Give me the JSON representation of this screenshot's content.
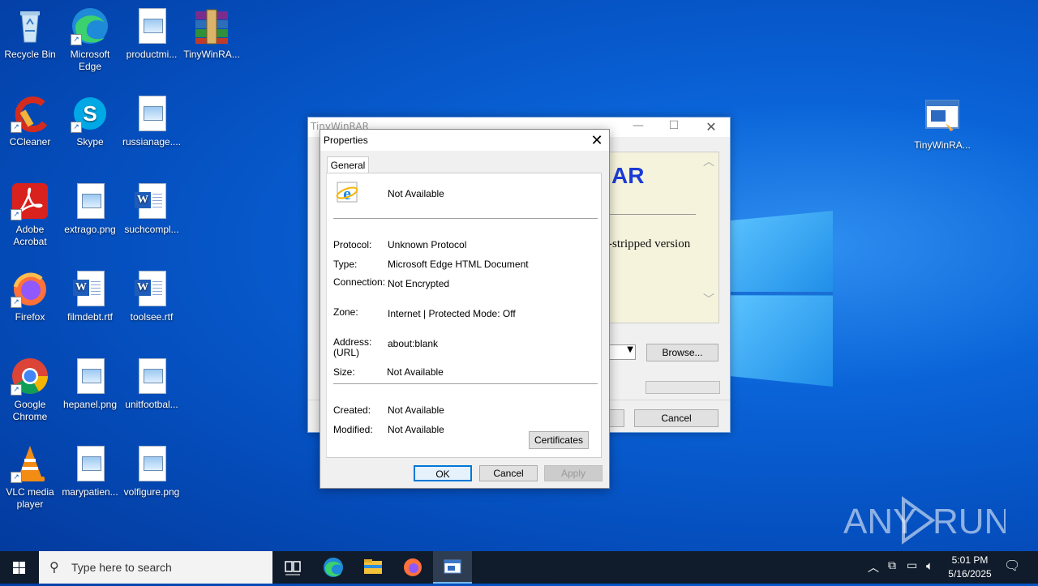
{
  "desktop_icons": [
    {
      "name": "recycle-bin",
      "label": "Recycle Bin"
    },
    {
      "name": "microsoft-edge",
      "label": "Microsoft Edge"
    },
    {
      "name": "productmi",
      "label": "productmi..."
    },
    {
      "name": "tinywinrar-archive",
      "label": "TinyWinRA..."
    },
    {
      "name": "ccleaner",
      "label": "CCleaner"
    },
    {
      "name": "skype",
      "label": "Skype"
    },
    {
      "name": "russianage",
      "label": "russianage...."
    },
    {
      "name": "adobe-acrobat",
      "label": "Adobe Acrobat"
    },
    {
      "name": "extrago",
      "label": "extrago.png"
    },
    {
      "name": "suchcompl",
      "label": "suchcompl..."
    },
    {
      "name": "firefox",
      "label": "Firefox"
    },
    {
      "name": "filmdebt",
      "label": "filmdebt.rtf"
    },
    {
      "name": "toolsee",
      "label": "toolsee.rtf"
    },
    {
      "name": "google-chrome",
      "label": "Google Chrome"
    },
    {
      "name": "hepanel",
      "label": "hepanel.png"
    },
    {
      "name": "unitfootbal",
      "label": "unitfootbal..."
    },
    {
      "name": "vlc",
      "label": "VLC media player"
    },
    {
      "name": "marypatien",
      "label": "marypatien..."
    },
    {
      "name": "volfigure",
      "label": "volfigure.png"
    },
    {
      "name": "tinywinrar-right",
      "label": "TinyWinRA..."
    }
  ],
  "bg_window": {
    "title": "TinyWinRAR",
    "heading_partial": "AR",
    "text_partial": "-stripped version",
    "browse_label": "Browse...",
    "cancel_label": "Cancel"
  },
  "dialog": {
    "title": "Properties",
    "tab": "General",
    "name_value": "Not Available",
    "protocol_label": "Protocol:",
    "protocol_value": "Unknown Protocol",
    "type_label": "Type:",
    "type_value": "Microsoft Edge HTML Document",
    "connection_label": "Connection:",
    "connection_value": "Not Encrypted",
    "zone_label": "Zone:",
    "zone_value": "Internet | Protected Mode: Off",
    "address_label": "Address:",
    "address_label2": "(URL)",
    "address_value": "about:blank",
    "size_label": "Size:",
    "size_value": "Not Available",
    "created_label": "Created:",
    "created_value": "Not Available",
    "modified_label": "Modified:",
    "modified_value": "Not Available",
    "certificates_label": "Certificates",
    "ok_label": "OK",
    "cancel_label": "Cancel",
    "apply_label": "Apply"
  },
  "taskbar": {
    "search_placeholder": "Type here to search",
    "time": "5:01 PM",
    "date": "5/16/2025"
  },
  "watermark": "ANY RUN"
}
